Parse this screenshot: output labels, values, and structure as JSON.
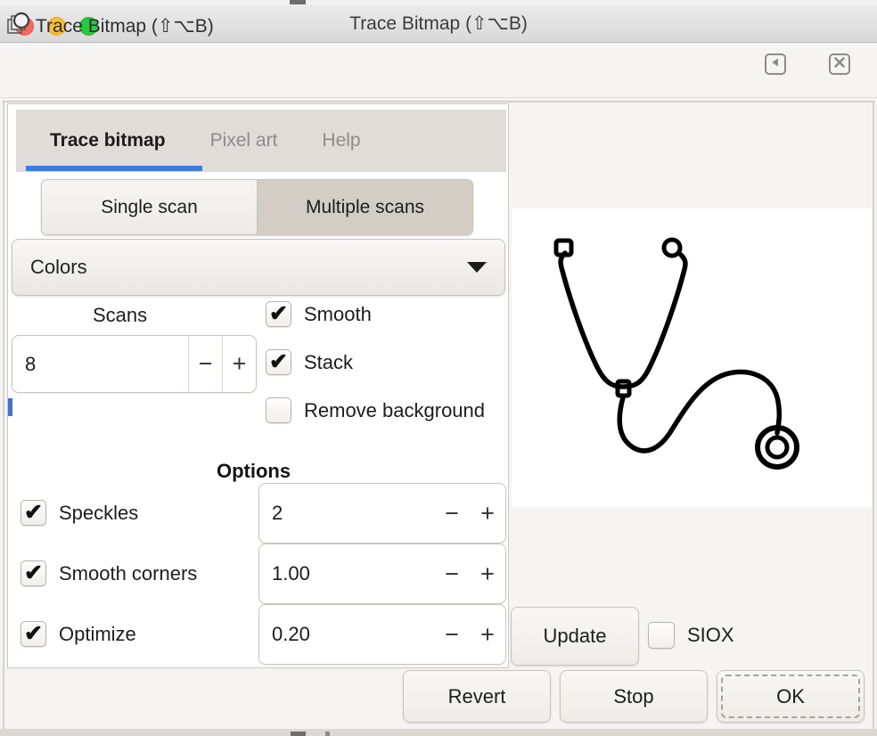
{
  "window": {
    "title": "Trace Bitmap (⇧⌥B)",
    "traffic_lights": [
      "close-red",
      "minimize-yellow",
      "zoom-green"
    ]
  },
  "dialog": {
    "icon": "trace-bitmap-icon",
    "title": "Trace Bitmap (⇧⌥B)",
    "dock_button": "◀",
    "close_button": "✖"
  },
  "tabs": [
    {
      "label": "Trace bitmap",
      "active": true
    },
    {
      "label": "Pixel art",
      "active": false
    },
    {
      "label": "Help",
      "active": false
    }
  ],
  "accent_color": "#3b7ddd",
  "scan_mode": {
    "options": [
      {
        "label": "Single scan",
        "selected": false
      },
      {
        "label": "Multiple scans",
        "selected": true
      }
    ]
  },
  "detection_mode": {
    "label": "Colors",
    "caret": "chevron-down-icon"
  },
  "scans": {
    "label": "Scans",
    "value": "8",
    "decrement": "−",
    "increment": "+"
  },
  "toggles": [
    {
      "name": "smooth",
      "label": "Smooth",
      "checked": true
    },
    {
      "name": "stack",
      "label": "Stack",
      "checked": true
    },
    {
      "name": "remove_background",
      "label": "Remove background",
      "checked": false
    }
  ],
  "options": {
    "title": "Options",
    "rows": [
      {
        "name": "speckles",
        "label": "Speckles",
        "checked": true,
        "value": "2"
      },
      {
        "name": "smooth_corners",
        "label": "Smooth corners",
        "checked": true,
        "value": "1.00"
      },
      {
        "name": "optimize",
        "label": "Optimize",
        "checked": true,
        "value": "0.20"
      }
    ],
    "decrement": "−",
    "increment": "+"
  },
  "preview": {
    "name": "trace-preview",
    "image": "stethoscope-line-drawing",
    "background": "#ffffff",
    "stroke": "#000000"
  },
  "actions": {
    "update": "Update",
    "siox_label": "SIOX",
    "siox_checked": false,
    "revert": "Revert",
    "stop": "Stop",
    "ok": "OK"
  },
  "tick_glyph": "✔"
}
